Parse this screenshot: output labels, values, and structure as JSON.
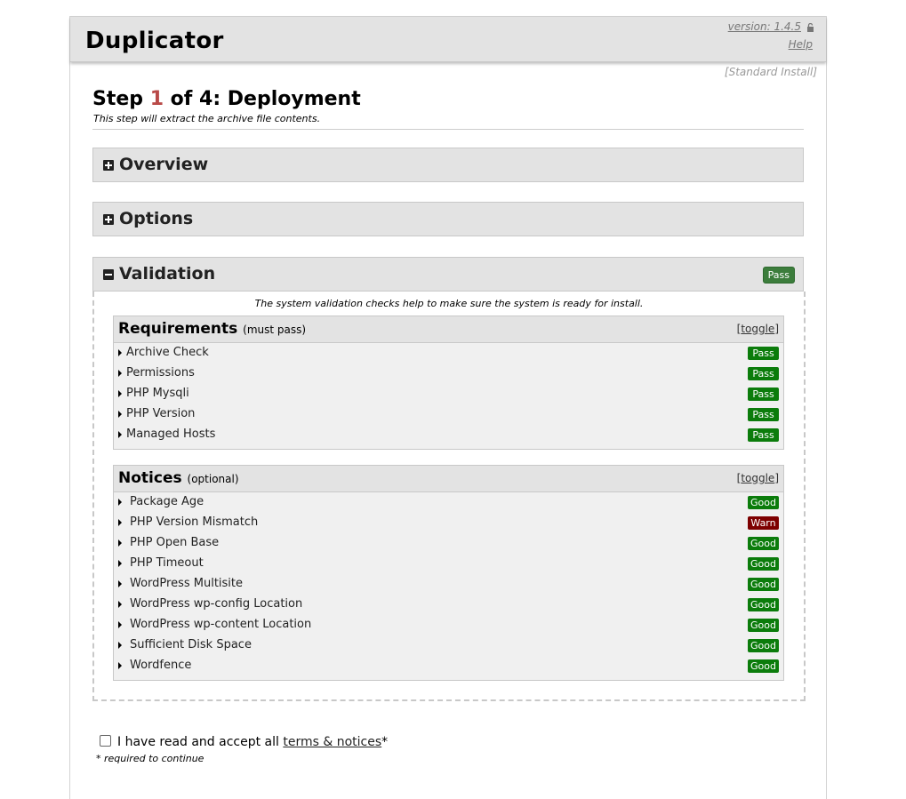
{
  "header": {
    "title": "Duplicator",
    "version": "version: 1.4.5",
    "help": "Help"
  },
  "install_type": "[Standard Install]",
  "step": {
    "prefix": "Step ",
    "number": "1",
    "suffix": " of 4: Deployment",
    "subtitle": "This step will extract the archive file contents."
  },
  "sections": {
    "overview": "Overview",
    "options": "Options",
    "validation": "Validation",
    "validation_badge": "Pass",
    "validation_note": "The system validation checks help to make sure the system is ready for install."
  },
  "requirements": {
    "title": "Requirements",
    "subtitle": "(must pass)",
    "toggle": "toggle",
    "items": [
      {
        "label": "Archive Check",
        "status": "Pass"
      },
      {
        "label": "Permissions",
        "status": "Pass"
      },
      {
        "label": "PHP Mysqli",
        "status": "Pass"
      },
      {
        "label": "PHP Version",
        "status": "Pass"
      },
      {
        "label": "Managed Hosts",
        "status": "Pass"
      }
    ]
  },
  "notices": {
    "title": "Notices",
    "subtitle": "(optional)",
    "toggle": "toggle",
    "items": [
      {
        "label": "Package Age",
        "status": "Good"
      },
      {
        "label": "PHP Version Mismatch",
        "status": "Warn"
      },
      {
        "label": "PHP Open Base",
        "status": "Good"
      },
      {
        "label": "PHP Timeout",
        "status": "Good"
      },
      {
        "label": "WordPress Multisite",
        "status": "Good"
      },
      {
        "label": "WordPress wp-config Location",
        "status": "Good"
      },
      {
        "label": "WordPress wp-content Location",
        "status": "Good"
      },
      {
        "label": "Sufficient Disk Space",
        "status": "Good"
      },
      {
        "label": "Wordfence",
        "status": "Good"
      }
    ]
  },
  "accept": {
    "text": "I have read and accept all ",
    "link": "terms & notices",
    "asterisk": "*",
    "required": "* required to continue"
  },
  "colors": {
    "pass": "#0b7c0b",
    "warn": "#7d0000",
    "step_number": "#b94a48"
  }
}
